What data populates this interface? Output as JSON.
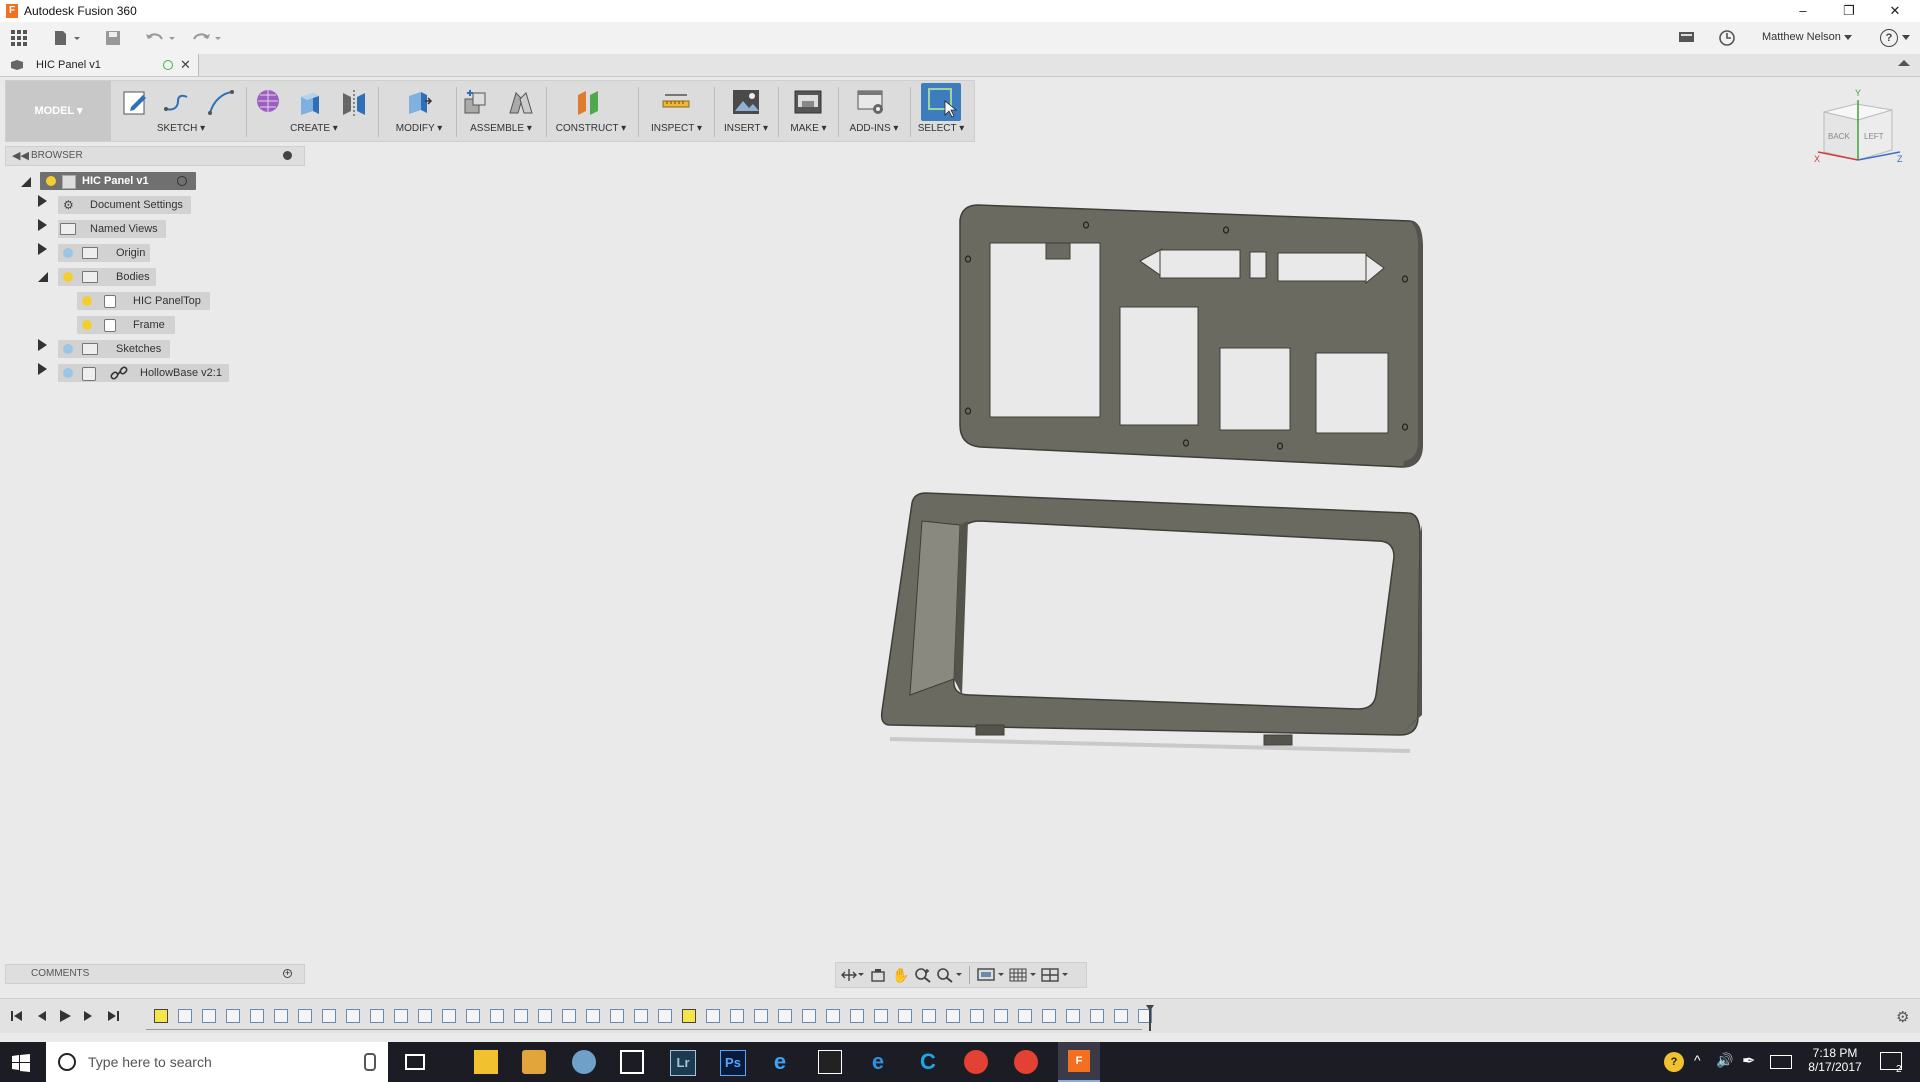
{
  "window": {
    "title": "Autodesk Fusion 360",
    "logo_letter": "F"
  },
  "appbar": {
    "user": "Matthew Nelson",
    "help": "?"
  },
  "document_tab": {
    "label": "HIC Panel v1"
  },
  "ribbon": {
    "workspace": "MODEL",
    "groups": [
      "SKETCH",
      "CREATE",
      "MODIFY",
      "ASSEMBLE",
      "CONSTRUCT",
      "INSPECT",
      "INSERT",
      "MAKE",
      "ADD-INS",
      "SELECT"
    ]
  },
  "browser": {
    "title": "BROWSER",
    "root": "HIC Panel v1",
    "items": [
      {
        "label": "Document Settings"
      },
      {
        "label": "Named Views"
      },
      {
        "label": "Origin"
      },
      {
        "label": "Bodies"
      },
      {
        "label": "HIC PanelTop"
      },
      {
        "label": "Frame"
      },
      {
        "label": "Sketches"
      },
      {
        "label": "HollowBase v2:1"
      }
    ]
  },
  "viewcube": {
    "faces": [
      "BACK",
      "LEFT"
    ],
    "axes": [
      "Y",
      "X",
      "Z"
    ]
  },
  "comments": {
    "title": "COMMENTS"
  },
  "taskbar": {
    "search_placeholder": "Type here to search",
    "apps": [
      "Lr",
      "Ps"
    ],
    "time": "7:18 PM",
    "date": "8/17/2017",
    "notifications": "2"
  },
  "colors": {
    "accent": "#3d7dbd",
    "model_part": "#6b6a60",
    "bulb": "#f2cf2e"
  }
}
